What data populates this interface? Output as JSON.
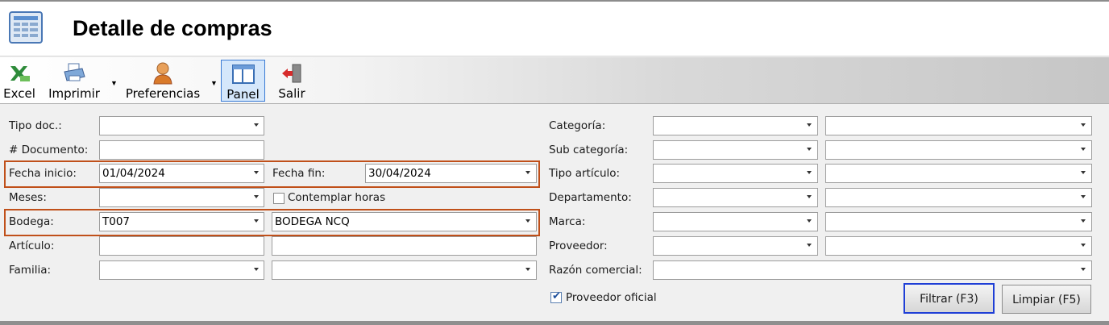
{
  "window": {
    "title": "Detalle de compras",
    "title_icon": "table-icon"
  },
  "toolbar": {
    "excel": {
      "label": "Excel",
      "icon": "excel-icon"
    },
    "imprimir": {
      "label": "Imprimir",
      "icon": "printer-icon"
    },
    "preferencias": {
      "label": "Preferencias",
      "icon": "user-icon"
    },
    "panel": {
      "label": "Panel",
      "icon": "panel-icon"
    },
    "salir": {
      "label": "Salir",
      "icon": "exit-icon"
    }
  },
  "form": {
    "tipo_doc": {
      "label": "Tipo doc.:",
      "value": ""
    },
    "documento": {
      "label": "# Documento:",
      "value": ""
    },
    "fecha_inicio": {
      "label": "Fecha inicio:",
      "value": "01/04/2024"
    },
    "fecha_fin": {
      "label": "Fecha fin:",
      "value": "30/04/2024"
    },
    "meses": {
      "label": "Meses:",
      "value": ""
    },
    "contemplar_horas": {
      "label": "Contemplar horas",
      "checked": false
    },
    "bodega": {
      "label": "Bodega:",
      "code": "T007",
      "name": "BODEGA NCQ"
    },
    "articulo": {
      "label": "Artículo:",
      "code": "",
      "name": ""
    },
    "familia": {
      "label": "Familia:",
      "code": "",
      "name": ""
    },
    "categoria": {
      "label": "Categoría:",
      "code": "",
      "name": ""
    },
    "sub_categoria": {
      "label": "Sub categoría:",
      "code": "",
      "name": ""
    },
    "tipo_articulo": {
      "label": "Tipo artículo:",
      "code": "",
      "name": ""
    },
    "departamento": {
      "label": "Departamento:",
      "code": "",
      "name": ""
    },
    "marca": {
      "label": "Marca:",
      "code": "",
      "name": ""
    },
    "proveedor": {
      "label": "Proveedor:",
      "code": "",
      "name": ""
    },
    "razon_comercial": {
      "label": "Razón comercial:",
      "value": ""
    },
    "proveedor_oficial": {
      "label": "Proveedor oficial",
      "checked": true
    }
  },
  "buttons": {
    "filtrar": "Filtrar (F3)",
    "limpiar": "Limpiar (F5)"
  },
  "colors": {
    "highlight": "#c0501a",
    "focus": "#1f3fd6"
  }
}
